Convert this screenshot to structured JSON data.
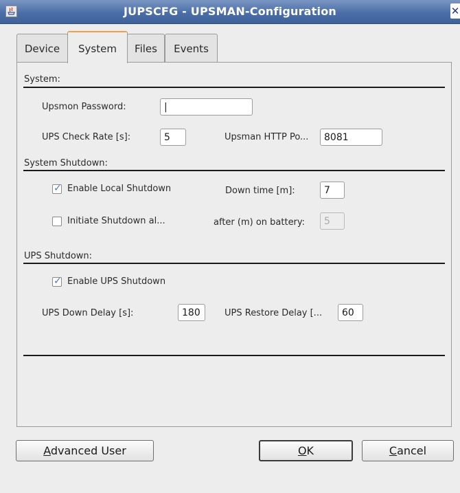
{
  "window": {
    "title": "JUPSCFG - UPSMAN-Configuration",
    "close_glyph": "✕"
  },
  "tabs": [
    {
      "label": "Device",
      "active": false
    },
    {
      "label": "System",
      "active": true
    },
    {
      "label": "Files",
      "active": false
    },
    {
      "label": "Events",
      "active": false
    }
  ],
  "system": {
    "section_label": "System:",
    "password_label": "Upsmon Password:",
    "password_value": "|",
    "check_rate_label": "UPS Check Rate [s]:",
    "check_rate_value": "5",
    "http_port_label": "Upsman HTTP Po...",
    "http_port_value": "8081"
  },
  "system_shutdown": {
    "section_label": "System Shutdown:",
    "enable_local_label": "Enable Local Shutdown",
    "enable_local_checked": true,
    "down_time_label": "Down time [m]:",
    "down_time_value": "7",
    "initiate_label": "Initiate Shutdown al...",
    "initiate_checked": false,
    "after_battery_label": "after (m) on battery:",
    "after_battery_value": "5"
  },
  "ups_shutdown": {
    "section_label": "UPS Shutdown:",
    "enable_ups_label": "Enable UPS Shutdown",
    "enable_ups_checked": true,
    "down_delay_label": "UPS Down Delay [s]:",
    "down_delay_value": "180",
    "restore_delay_label": "UPS Restore Delay [...",
    "restore_delay_value": "60"
  },
  "buttons": {
    "advanced_mnemonic": "A",
    "advanced_rest": "dvanced User",
    "ok_mnemonic": "O",
    "ok_rest": "K",
    "cancel_mnemonic": "C",
    "cancel_rest": "ancel"
  },
  "colors": {
    "titlebar": "#4b6ea8",
    "active_tab_accent": "#f0a04b",
    "check_color": "#4a78c2"
  },
  "icons": {
    "app_icon": "java-icon",
    "close": "close-icon",
    "check": "checkmark-icon"
  }
}
